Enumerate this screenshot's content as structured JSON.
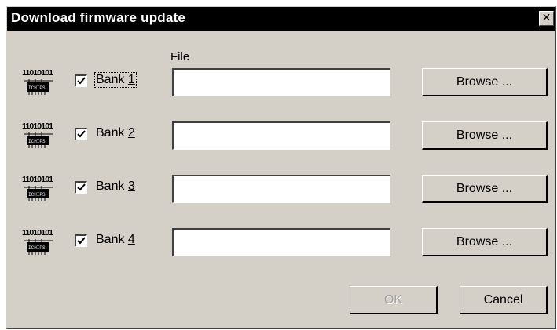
{
  "dialog": {
    "title": "Download firmware update",
    "close_glyph": "✕",
    "file_header": "File"
  },
  "banks": [
    {
      "label_prefix": "Bank ",
      "label_key": "1",
      "checked": true,
      "file": "",
      "browse_label": "Browse ..."
    },
    {
      "label_prefix": "Bank ",
      "label_key": "2",
      "checked": true,
      "file": "",
      "browse_label": "Browse ..."
    },
    {
      "label_prefix": "Bank ",
      "label_key": "3",
      "checked": true,
      "file": "",
      "browse_label": "Browse ..."
    },
    {
      "label_prefix": "Bank ",
      "label_key": "4",
      "checked": true,
      "file": "",
      "browse_label": "Browse ..."
    }
  ],
  "icon": {
    "name": "firmware-chip-icon",
    "binary_text": "11010101",
    "chip_text": "ICHIPS"
  },
  "buttons": {
    "ok_label": "OK",
    "ok_enabled": false,
    "cancel_label": "Cancel"
  },
  "colors": {
    "titlebar": "#000000",
    "dialog_bg": "#d4d0c8",
    "disabled_text": "#a0a0a0"
  }
}
